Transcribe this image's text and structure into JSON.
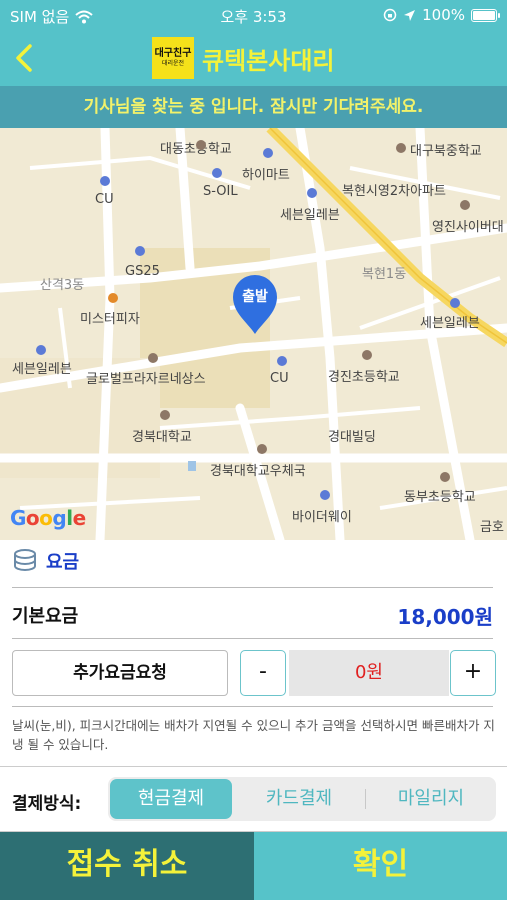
{
  "status_bar": {
    "carrier": "SIM 없음",
    "time": "오후 3:53",
    "battery": "100%",
    "icons": [
      "wifi-icon",
      "rotation-lock-icon",
      "location-arrow-icon",
      "battery-icon"
    ]
  },
  "header": {
    "back_icon": "chevron-left-icon",
    "logo_main": "대구친구",
    "logo_sub": "대리운전",
    "title": "큐텍본사대리"
  },
  "banner": {
    "text": "기사님을 찾는 중 입니다.  잠시만 기다려주세요."
  },
  "map": {
    "pin_label": "출발",
    "attribution": [
      "G",
      "o",
      "o",
      "g",
      "l",
      "e"
    ],
    "labels": {
      "dongseong_school": "대동초등학교",
      "daegu_bukjung": "대구북중학교",
      "himart": "하이마트",
      "cu1": "CU",
      "soil": "S-OIL",
      "bokhyeon_apt": "복현시영2차아파트",
      "seven1": "세븐일레븐",
      "youngjin": "영진사이버대",
      "sangyeok": "산격3동",
      "gs25": "GS25",
      "bokhyeon1": "복현1동",
      "mister_pizza": "미스터피자",
      "seven2": "세븐일레븐",
      "seven3": "세븐일레븐",
      "global_plaza": "글로벌프라자르네상스",
      "cu2": "CU",
      "gyeongjin_school": "경진초등학교",
      "knu": "경북대학교",
      "gyeongdae_bldg": "경대빌딩",
      "knu_post": "경북대학교우체국",
      "dongbu_school": "동부초등학교",
      "biderway": "바이더웨이",
      "geumho": "금호"
    }
  },
  "fare": {
    "section_icon": "coins-icon",
    "title": "요금",
    "base_label": "기본요금",
    "base_value": "18,000원",
    "extra_request_label": "추가요금요청",
    "minus_label": "-",
    "extra_amount": "0원",
    "plus_label": "+",
    "notice": "날씨(눈,비), 피크시간대에는 배차가 지연될 수 있으니 추가 금액을 선택하시면 빠른배차가 지냉 될 수 있습니다."
  },
  "payment": {
    "label": "결제방식:",
    "options": [
      "현금결제",
      "카드결제",
      "마일리지"
    ],
    "selected": "현금결제"
  },
  "actions": {
    "cancel_label": "접수 취소",
    "confirm_label": "확인"
  },
  "colors": {
    "header_bg": "#55c2c9",
    "banner_bg": "#4aa0b0",
    "accent_yellow": "#f4f23a",
    "fare_blue": "#1a3ec8",
    "amount_red": "#e02020",
    "cancel_bg": "#2d6f73"
  }
}
